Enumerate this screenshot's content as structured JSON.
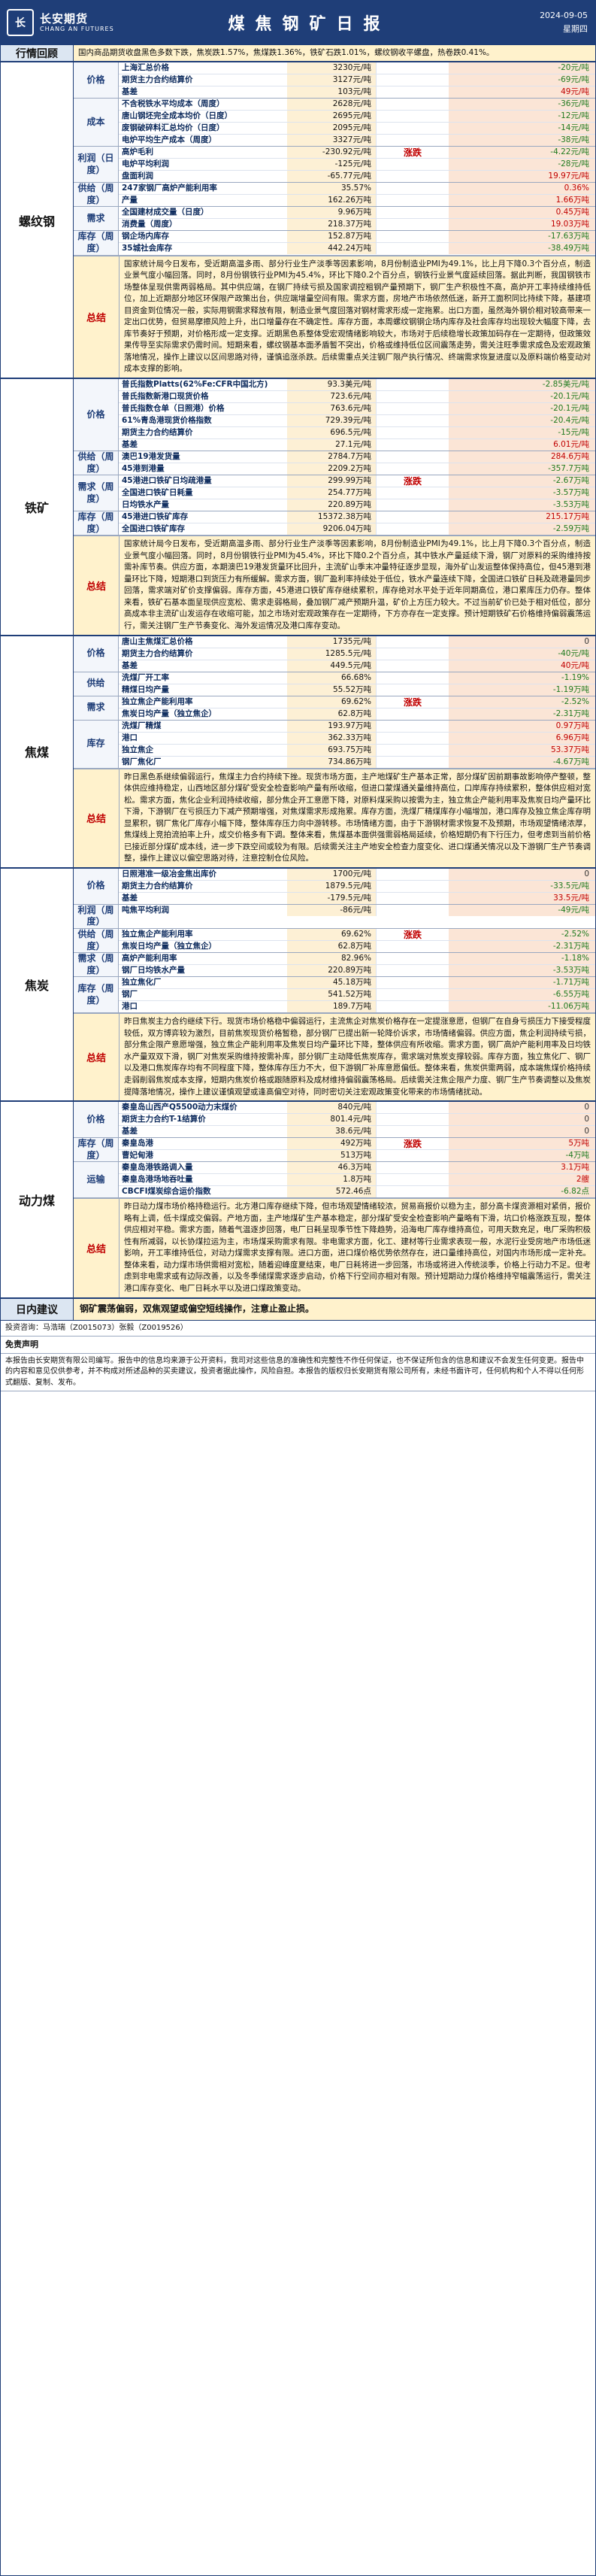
{
  "header": {
    "logo_cn": "长安期货",
    "logo_en": "CHANG AN FUTURES",
    "logo_mark": "长",
    "title": "煤焦钢矿日报",
    "date": "2024-09-05",
    "weekday": "星期四"
  },
  "review": {
    "label": "行情回顾",
    "text": "国内商品期货收盘黑色多数下跌，焦炭跌1.57%，焦煤跌1.36%，铁矿石跌1.01%，螺纹钢收平螺盘，热卷跌0.41%。"
  },
  "blocks": [
    {
      "name": "螺纹钢",
      "groups": [
        {
          "cat": "价格",
          "rows": [
            {
              "name": "上海汇总价格",
              "value": "3230元/吨",
              "change": "-20元/吨",
              "dir": "neg"
            },
            {
              "name": "期货主力合约结算价",
              "value": "3127元/吨",
              "change": "-69元/吨",
              "dir": "neg"
            },
            {
              "name": "基差",
              "value": "103元/吨",
              "change": "49元/吨",
              "dir": "pos"
            }
          ]
        },
        {
          "cat": "成本",
          "rows": [
            {
              "name": "不含税铁水平均成本（周度）",
              "value": "2628元/吨",
              "change": "-36元/吨",
              "dir": "neg"
            },
            {
              "name": "唐山钢坯完全成本均价（日度）",
              "value": "2695元/吨",
              "change": "-12元/吨",
              "dir": "neg"
            },
            {
              "name": "废钢破碎料汇总均价（日度）",
              "value": "2095元/吨",
              "change": "-14元/吨",
              "dir": "neg"
            },
            {
              "name": "电炉平均生产成本（周度）",
              "value": "3327元/吨",
              "change": "-38元/吨",
              "dir": "neg"
            }
          ]
        },
        {
          "cat": "利润（日度）",
          "mid": "涨跌",
          "rows": [
            {
              "name": "高炉毛利",
              "value": "-230.92元/吨",
              "change": "-4.22元/吨",
              "dir": "neg"
            },
            {
              "name": "电炉平均利润",
              "value": "-125元/吨",
              "change": "-28元/吨",
              "dir": "neg"
            },
            {
              "name": "盘面利润",
              "value": "-65.77元/吨",
              "change": "19.97元/吨",
              "dir": "pos"
            }
          ]
        },
        {
          "cat": "供给（周度）",
          "rows": [
            {
              "name": "247家钢厂高炉产能利用率",
              "value": "35.57%",
              "change": "0.36%",
              "dir": "pos"
            },
            {
              "name": "产量",
              "value": "162.26万吨",
              "change": "1.66万吨",
              "dir": "pos"
            }
          ]
        },
        {
          "cat": "需求",
          "rows": [
            {
              "name": "全国建材成交量（日度）",
              "value": "9.96万吨",
              "change": "0.45万吨",
              "dir": "pos"
            },
            {
              "name": "消费量（周度）",
              "value": "218.37万吨",
              "change": "19.03万吨",
              "dir": "pos"
            }
          ]
        },
        {
          "cat": "库存（周度）",
          "rows": [
            {
              "name": "钢企场内库存",
              "value": "152.87万吨",
              "change": "-17.63万吨",
              "dir": "neg"
            },
            {
              "name": "35城社会库存",
              "value": "442.24万吨",
              "change": "-38.49万吨",
              "dir": "neg"
            }
          ]
        }
      ],
      "summary": "国家统计局今日发布，受近期高温多雨、部分行业生产淡季等因素影响，8月份制造业PMI为49.1%，比上月下降0.3个百分点，制造业景气度小幅回落。同时，8月份钢铁行业PMI为45.4%，环比下降0.2个百分点，钢铁行业景气度延续回落。据此判断，我国钢铁市场整体呈现供需两弱格局。其中供应端，在钢厂持续亏损及国家调控粗钢产量预期下，钢厂生产积极性不高，高炉开工率持续维持低位，加上近期部分地区环保限产政策出台，供应端增量空间有限。需求方面，房地产市场依然低迷，新开工面积同比持续下降，基建项目资金到位情况一般，实际用钢需求释放有限，制造业景气度回落对钢材需求形成一定拖累。出口方面，虽然海外钢价相对较高带来一定出口优势，但贸易摩擦风险上升，出口增量存在不确定性。库存方面，本周螺纹钢钢企场内库存及社会库存均出现较大幅度下降，去库节奏好于预期，对价格形成一定支撑。近期黑色系整体受宏观情绪影响较大，市场对于后续稳增长政策加码存在一定期待，但政策效果传导至实际需求仍需时间。短期来看，螺纹钢基本面矛盾暂不突出，价格或维持低位区间震荡走势，需关注旺季需求成色及宏观政策落地情况，操作上建议以区间思路对待，谨慎追涨杀跌。后续需重点关注钢厂限产执行情况、终端需求恢复进度以及原料端价格变动对成本支撑的影响。"
    },
    {
      "name": "铁矿",
      "groups": [
        {
          "cat": "价格",
          "rows": [
            {
              "name": "普氏指数Platts(62%Fe:CFR中国北方)",
              "value": "93.3美元/吨",
              "change": "-2.85美元/吨",
              "dir": "neg"
            },
            {
              "name": "普氏指数新港口现货价格",
              "value": "723.6元/吨",
              "change": "-20.1元/吨",
              "dir": "neg"
            },
            {
              "name": "普氏指数仓单（日照港）价格",
              "value": "763.6元/吨",
              "change": "-20.1元/吨",
              "dir": "neg"
            },
            {
              "name": "61%青岛港现货价格指数",
              "value": "729.39元/吨",
              "change": "-20.4元/吨",
              "dir": "neg"
            },
            {
              "name": "期货主力合约结算价",
              "value": "696.5元/吨",
              "change": "-15元/吨",
              "dir": "neg"
            },
            {
              "name": "基差",
              "value": "27.1元/吨",
              "change": "6.01元/吨",
              "dir": "pos"
            }
          ]
        },
        {
          "cat": "供给（周度）",
          "rows": [
            {
              "name": "澳巴19港发货量",
              "value": "2784.7万吨",
              "change": "284.6万吨",
              "dir": "pos"
            },
            {
              "name": "45港到港量",
              "value": "2209.2万吨",
              "change": "-357.7万吨",
              "dir": "neg"
            }
          ]
        },
        {
          "cat": "需求（周度）",
          "mid": "涨跌",
          "rows": [
            {
              "name": "45港进口铁矿日均疏港量",
              "value": "299.99万吨",
              "change": "-2.67万吨",
              "dir": "neg"
            },
            {
              "name": "全国进口铁矿日耗量",
              "value": "254.77万吨",
              "change": "-3.57万吨",
              "dir": "neg"
            },
            {
              "name": "日均铁水产量",
              "value": "220.89万吨",
              "change": "-3.53万吨",
              "dir": "neg"
            }
          ]
        },
        {
          "cat": "库存（周度）",
          "rows": [
            {
              "name": "45港进口铁矿库存",
              "value": "15372.38万吨",
              "change": "215.17万吨",
              "dir": "pos"
            },
            {
              "name": "全国进口铁矿库存",
              "value": "9206.04万吨",
              "change": "-2.59万吨",
              "dir": "neg"
            }
          ]
        }
      ],
      "summary": "国家统计局今日发布，受近期高温多雨、部分行业生产淡季等因素影响，8月份制造业PMI为49.1%，比上月下降0.3个百分点，制造业景气度小幅回落。同时，8月份钢铁行业PMI为45.4%，环比下降0.2个百分点，其中铁水产量延续下滑，钢厂对原料的采购维持按需补库节奏。供应方面，本期澳巴19港发货量环比回升，主流矿山季末冲量特征逐步显现，海外矿山发运整体保持高位，但45港到港量环比下降，短期港口到货压力有所缓解。需求方面，钢厂盈利率持续处于低位，铁水产量连续下降，全国进口铁矿日耗及疏港量同步回落，需求端对矿价支撑偏弱。库存方面，45港进口铁矿库存继续累积，库存绝对水平处于近年同期高位，港口累库压力仍存。整体来看，铁矿石基本面呈现供应宽松、需求走弱格局，叠加钢厂减产预期升温，矿价上方压力较大。不过当前矿价已处于相对低位，部分高成本非主流矿山发运存在收缩可能，加之市场对宏观政策存在一定期待，下方亦存在一定支撑。预计短期铁矿石价格维持偏弱震荡运行，需关注钢厂生产节奏变化、海外发运情况及港口库存变动。"
    },
    {
      "name": "焦煤",
      "groups": [
        {
          "cat": "价格",
          "rows": [
            {
              "name": "唐山主焦煤汇总价格",
              "value": "1735元/吨",
              "change": "0",
              "dir": "zero"
            },
            {
              "name": "期货主力合约结算价",
              "value": "1285.5元/吨",
              "change": "-40元/吨",
              "dir": "neg"
            },
            {
              "name": "基差",
              "value": "449.5元/吨",
              "change": "40元/吨",
              "dir": "pos"
            }
          ]
        },
        {
          "cat": "供给",
          "rows": [
            {
              "name": "洗煤厂开工率",
              "value": "66.68%",
              "change": "-1.19%",
              "dir": "neg"
            },
            {
              "name": "精煤日均产量",
              "value": "55.52万吨",
              "change": "-1.19万吨",
              "dir": "neg"
            }
          ]
        },
        {
          "cat": "需求",
          "mid": "涨跌",
          "rows": [
            {
              "name": "独立焦企产能利用率",
              "value": "69.62%",
              "change": "-2.52%",
              "dir": "neg"
            },
            {
              "name": "焦炭日均产量（独立焦企）",
              "value": "62.8万吨",
              "change": "-2.31万吨",
              "dir": "neg"
            }
          ]
        },
        {
          "cat": "库存",
          "rows": [
            {
              "name": "洗煤厂精煤",
              "value": "193.97万吨",
              "change": "0.97万吨",
              "dir": "pos"
            },
            {
              "name": "港口",
              "value": "362.33万吨",
              "change": "6.96万吨",
              "dir": "pos"
            },
            {
              "name": "独立焦企",
              "value": "693.75万吨",
              "change": "53.37万吨",
              "dir": "pos"
            },
            {
              "name": "钢厂焦化厂",
              "value": "734.86万吨",
              "change": "-4.67万吨",
              "dir": "neg"
            }
          ]
        }
      ],
      "summary": "昨日黑色系继续偏弱运行，焦煤主力合约持续下挫。现货市场方面，主产地煤矿生产基本正常，部分煤矿因前期事故影响停产整顿，整体供应维持稳定，山西地区部分煤矿受安全检查影响产量有所收缩，但进口蒙煤通关量维持高位，口岸库存持续累积，整体供应相对宽松。需求方面，焦化企业利润持续收缩，部分焦企开工意愿下降，对原料煤采购以按需为主，独立焦企产能利用率及焦炭日均产量环比下滑，下游钢厂在亏损压力下减产预期增强，对焦煤需求形成拖累。库存方面，洗煤厂精煤库存小幅增加，港口库存及独立焦企库存明显累积，钢厂焦化厂库存小幅下降，整体库存压力向中游转移。市场情绪方面，由于下游钢材需求恢复不及预期，市场观望情绪浓厚，焦煤线上竞拍流拍率上升，成交价格多有下调。整体来看，焦煤基本面供强需弱格局延续，价格短期仍有下行压力，但考虑到当前价格已接近部分煤矿成本线，进一步下跌空间或较为有限。后续需关注主产地安全检查力度变化、进口煤通关情况以及下游钢厂生产节奏调整，操作上建议以偏空思路对待，注意控制仓位风险。"
    },
    {
      "name": "焦炭",
      "groups": [
        {
          "cat": "价格",
          "rows": [
            {
              "name": "日照港准一级冶金焦出库价",
              "value": "1700元/吨",
              "change": "0",
              "dir": "zero"
            },
            {
              "name": "期货主力合约结算价",
              "value": "1879.5元/吨",
              "change": "-33.5元/吨",
              "dir": "neg"
            },
            {
              "name": "基差",
              "value": "-179.5元/吨",
              "change": "33.5元/吨",
              "dir": "pos"
            }
          ]
        },
        {
          "cat": "利润（周度）",
          "rows": [
            {
              "name": "吨焦平均利润",
              "value": "-86元/吨",
              "change": "-49元/吨",
              "dir": "neg"
            }
          ]
        },
        {
          "cat": "供给（周度）",
          "mid": "涨跌",
          "rows": [
            {
              "name": "独立焦企产能利用率",
              "value": "69.62%",
              "change": "-2.52%",
              "dir": "neg"
            },
            {
              "name": "焦炭日均产量（独立焦企）",
              "value": "62.8万吨",
              "change": "-2.31万吨",
              "dir": "neg"
            }
          ]
        },
        {
          "cat": "需求（周度）",
          "rows": [
            {
              "name": "高炉产能利用率",
              "value": "82.96%",
              "change": "-1.18%",
              "dir": "neg"
            },
            {
              "name": "钢厂日均铁水产量",
              "value": "220.89万吨",
              "change": "-3.53万吨",
              "dir": "neg"
            }
          ]
        },
        {
          "cat": "库存（周度）",
          "rows": [
            {
              "name": "独立焦化厂",
              "value": "45.18万吨",
              "change": "-1.71万吨",
              "dir": "neg"
            },
            {
              "name": "钢厂",
              "value": "541.52万吨",
              "change": "-6.55万吨",
              "dir": "neg"
            },
            {
              "name": "港口",
              "value": "189.7万吨",
              "change": "-11.06万吨",
              "dir": "neg"
            }
          ]
        }
      ],
      "summary": "昨日焦炭主力合约继续下行。现货市场价格稳中偏弱运行，主流焦企对焦炭价格存在一定提涨意愿，但钢厂在自身亏损压力下接受程度较低，双方博弈较为激烈，目前焦炭现货价格暂稳，部分钢厂已提出新一轮降价诉求，市场情绪偏弱。供应方面，焦企利润持续亏损，部分焦企限产意愿增强，独立焦企产能利用率及焦炭日均产量环比下降，整体供应有所收缩。需求方面，钢厂高炉产能利用率及日均铁水产量双双下滑，钢厂对焦炭采购维持按需补库，部分钢厂主动降低焦炭库存，需求端对焦炭支撑较弱。库存方面，独立焦化厂、钢厂以及港口焦炭库存均有不同程度下降，整体库存压力不大，但下游钢厂补库意愿偏低。整体来看，焦炭供需两弱，成本端焦煤价格持续走弱削弱焦炭成本支撑，短期内焦炭价格或跟随原料及成材维持偏弱震荡格局。后续需关注焦企限产力度、钢厂生产节奏调整以及焦炭提降落地情况，操作上建议谨慎观望或逢高偏空对待，同时密切关注宏观政策变化带来的市场情绪扰动。"
    },
    {
      "name": "动力煤",
      "groups": [
        {
          "cat": "价格",
          "rows": [
            {
              "name": "秦皇岛山西产Q5500动力末煤价",
              "value": "840元/吨",
              "change": "0",
              "dir": "zero"
            },
            {
              "name": "期货主力合约T-1结算价",
              "value": "801.4元/吨",
              "change": "0",
              "dir": "zero"
            },
            {
              "name": "基差",
              "value": "38.6元/吨",
              "change": "0",
              "dir": "zero"
            }
          ]
        },
        {
          "cat": "库存（周度）",
          "mid": "涨跌",
          "rows": [
            {
              "name": "秦皇岛港",
              "value": "492万吨",
              "change": "5万吨",
              "dir": "pos"
            },
            {
              "name": "曹妃甸港",
              "value": "513万吨",
              "change": "-4万吨",
              "dir": "neg"
            }
          ]
        },
        {
          "cat": "运输",
          "rows": [
            {
              "name": "秦皇岛港铁路调入量",
              "value": "46.3万吨",
              "change": "3.1万吨",
              "dir": "pos"
            },
            {
              "name": "秦皇岛港场地吞吐量",
              "value": "1.8万吨",
              "change": "2艘",
              "dir": "pos"
            },
            {
              "name": "CBCFI煤炭综合运价指数",
              "value": "572.46点",
              "change": "-6.82点",
              "dir": "neg"
            }
          ]
        }
      ],
      "summary": "昨日动力煤市场价格持稳运行。北方港口库存继续下降，但市场观望情绪较浓，贸易商报价以稳为主，部分高卡煤资源相对紧俏，报价略有上调，低卡煤成交偏弱。产地方面，主产地煤矿生产基本稳定，部分煤矿受安全检查影响产量略有下滑，坑口价格涨跌互现，整体供应相对平稳。需求方面，随着气温逐步回落，电厂日耗呈现季节性下降趋势，沿海电厂库存维持高位，可用天数充足，电厂采购积极性有所减弱，以长协煤拉运为主，市场煤采购需求有限。非电需求方面，化工、建材等行业需求表现一般，水泥行业受房地产市场低迷影响，开工率维持低位，对动力煤需求支撑有限。进口方面，进口煤价格优势依然存在，进口量维持高位，对国内市场形成一定补充。整体来看，动力煤市场供需相对宽松，随着迎峰度夏结束，电厂日耗将进一步回落，市场或将进入传统淡季，价格上行动力不足。但考虑到非电需求或有边际改善，以及冬季储煤需求逐步启动，价格下行空间亦相对有限。预计短期动力煤价格维持窄幅震荡运行，需关注港口库存变化、电厂日耗水平以及进口煤政策变动。"
    }
  ],
  "advice": {
    "label": "日内建议",
    "text": "钢矿震荡偏弱，双焦观望或偏空短线操作，注意止盈止损。"
  },
  "footer": {
    "analyst": "投资咨询：马浩瑞（Z0015073）张毅（Z0019526）",
    "disclaimer_title": "免责声明",
    "disclaimer": "本报告由长安期货有限公司编写。报告中的信息均来源于公开资料，我司对这些信息的准确性和完整性不作任何保证，也不保证所包含的信息和建议不会发生任何变更。报告中的内容和意见仅供参考，并不构成对所述品种的买卖建议，投资者据此操作，风险自担。本报告的版权归长安期货有限公司所有，未经书面许可，任何机构和个人不得以任何形式翻版、复制、发布。"
  }
}
